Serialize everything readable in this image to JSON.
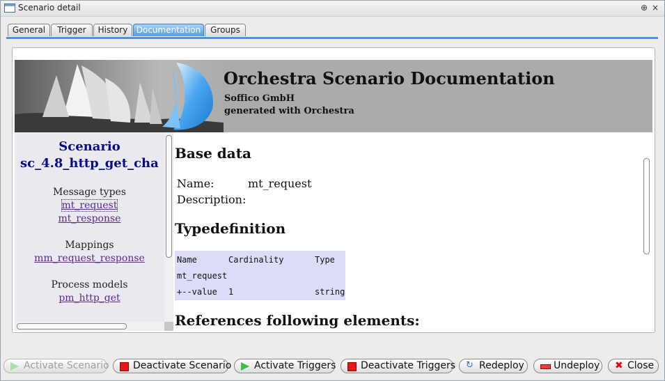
{
  "window": {
    "title": "Scenario detail",
    "restore_glyph": "⊕",
    "close_glyph": "×"
  },
  "tabs": [
    {
      "label": "General"
    },
    {
      "label": "Trigger"
    },
    {
      "label": "History"
    },
    {
      "label": "Documentation",
      "active": true
    },
    {
      "label": "Groups"
    }
  ],
  "banner": {
    "title": "Orchestra Scenario Documentation",
    "company": "Soffico GmbH",
    "generated": "generated with Orchestra"
  },
  "nav": {
    "scenario_label": "Scenario",
    "scenario_name": "sc_4.8_http_get_cha",
    "sections": [
      {
        "title": "Message types",
        "links": [
          "mt_request",
          "mt_response"
        ]
      },
      {
        "title": "Mappings",
        "links": [
          "mm_request_response"
        ]
      },
      {
        "title": "Process models",
        "links": [
          "pm_http_get"
        ]
      }
    ]
  },
  "doc": {
    "base_heading": "Base data",
    "name_label": "Name:",
    "name_value": "mt_request",
    "description_label": "Description:",
    "typedef_heading": "Typedefinition",
    "type_table": {
      "headers": [
        "Name",
        "Cardinality",
        "Type"
      ],
      "rows": [
        [
          "mt_request",
          "",
          ""
        ],
        [
          "+--value",
          "1",
          "string"
        ]
      ]
    },
    "refs_heading": "References following elements:"
  },
  "buttons": {
    "activate_scenario": "Activate Scenario",
    "deactivate_scenario": "Deactivate Scenario",
    "activate_triggers": "Activate Triggers",
    "deactivate_triggers": "Deactivate Triggers",
    "redeploy": "Redeploy",
    "undeploy": "Undeploy",
    "close": "Close"
  },
  "icons": {
    "play": "play-icon",
    "stop": "stop-icon",
    "redeploy": "redeploy-icon",
    "undeploy": "undeploy-icon",
    "close": "close-x-icon"
  },
  "colors": {
    "tab_active": "#4d9fe8",
    "tab_underline": "#3f97e8",
    "scenario_title": "#0b0b8a",
    "link": "#5a2a8a",
    "type_table_bg": "#dcdcf8",
    "banner_bg": "#a9abad",
    "stop_red": "#e01818",
    "play_green": "#3fbf3f"
  }
}
